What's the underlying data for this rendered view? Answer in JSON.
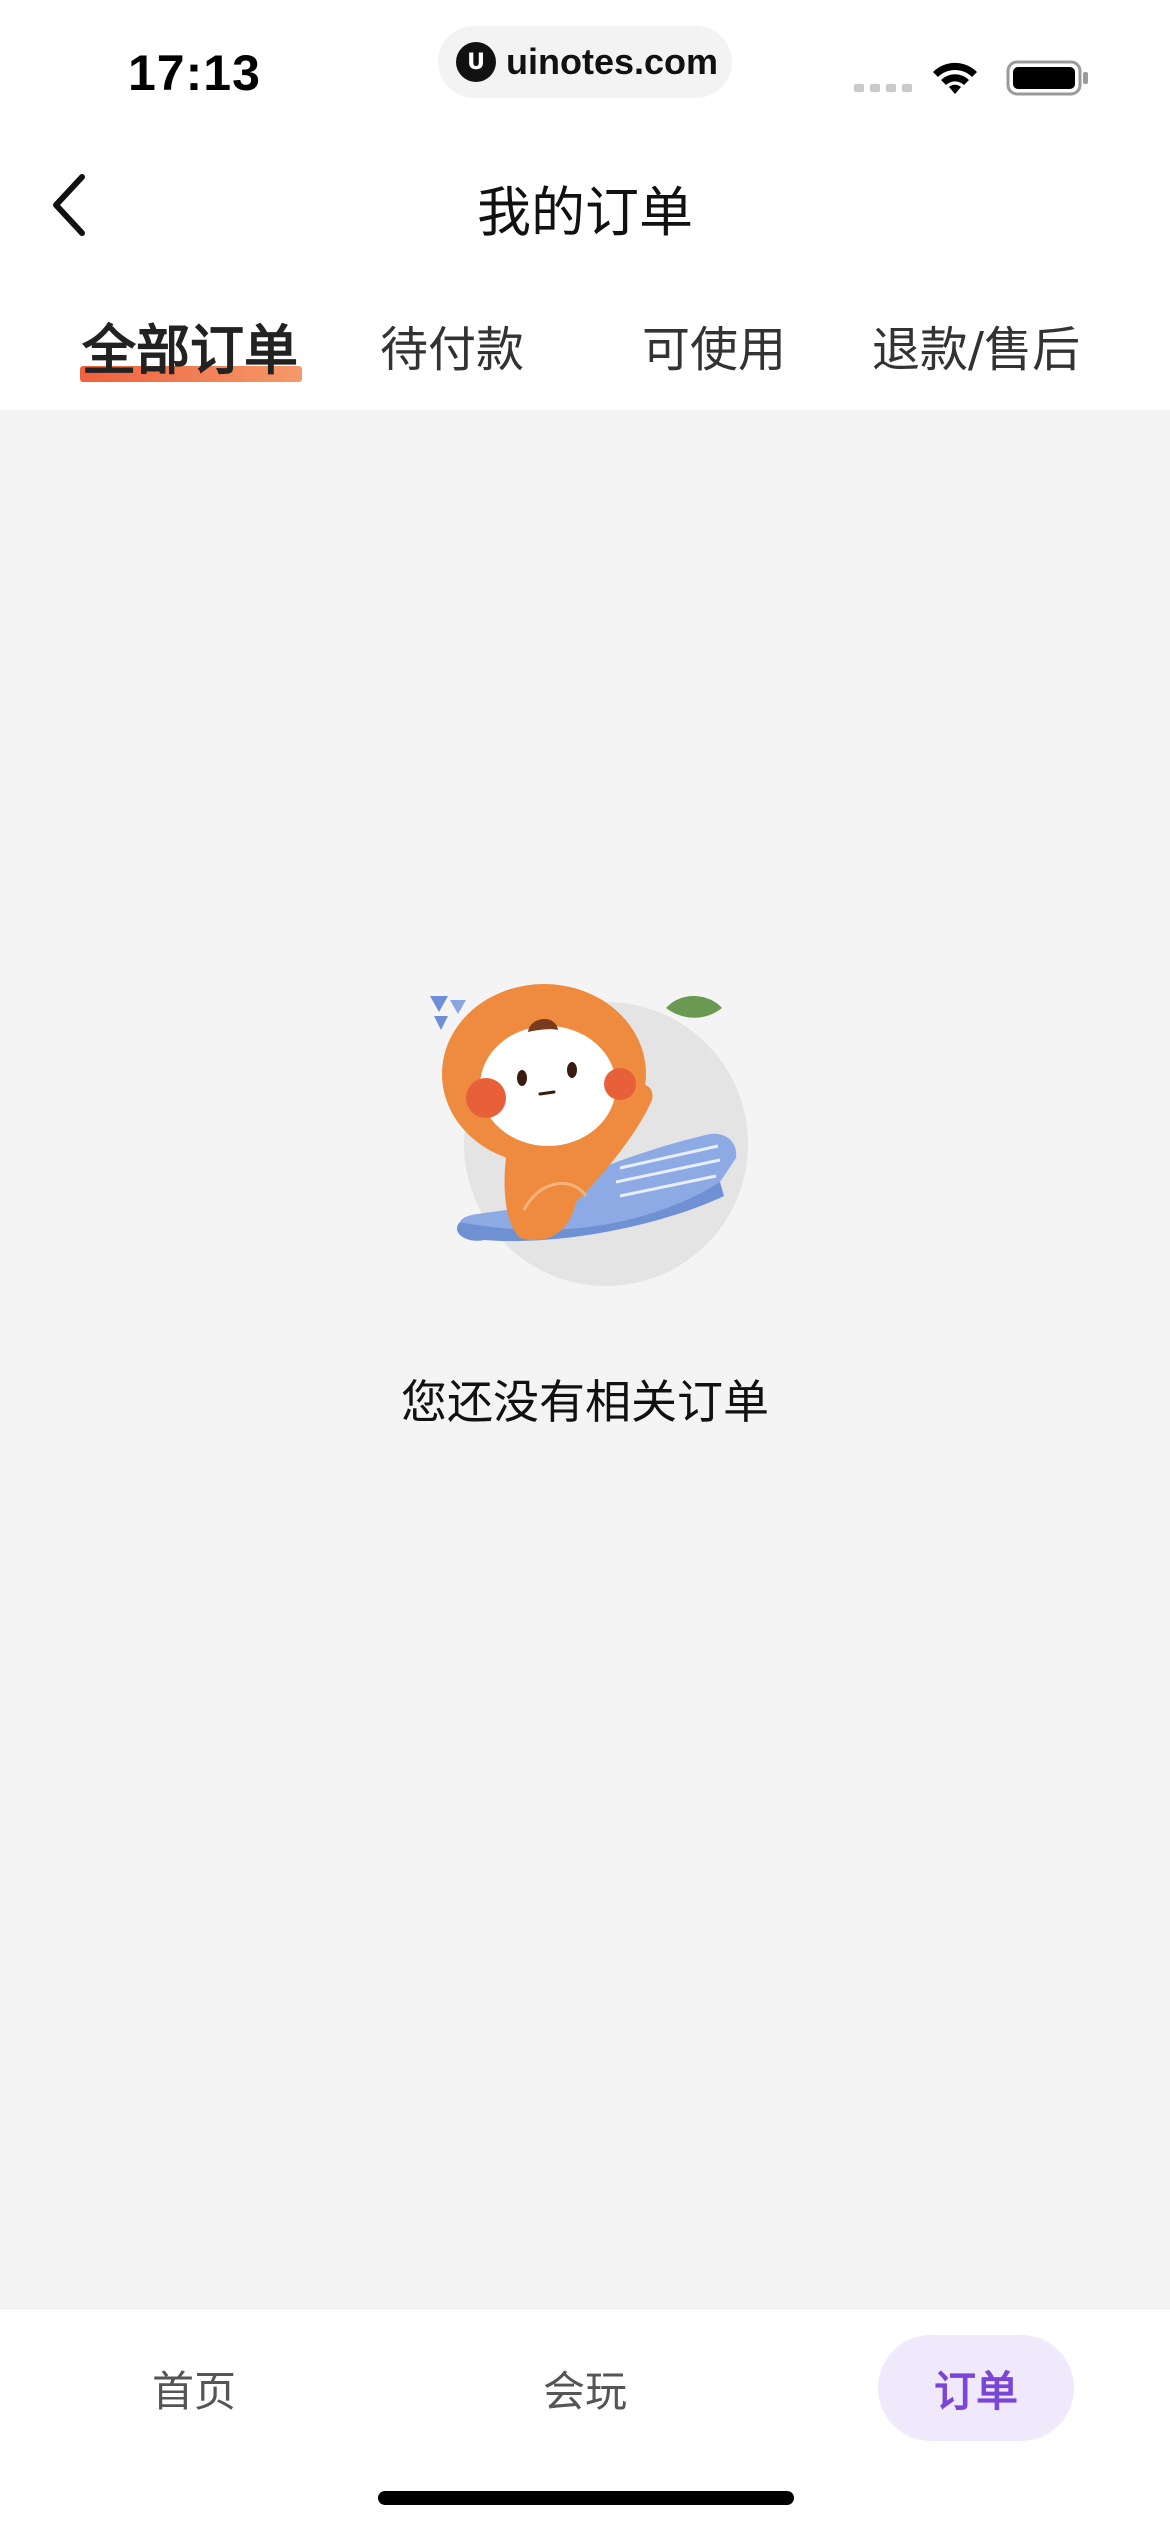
{
  "status_bar": {
    "time": "17:13",
    "url": "uinotes.com",
    "url_logo_glyph": "U",
    "icons": [
      "signal-icon",
      "wifi-icon",
      "battery-icon"
    ]
  },
  "header": {
    "title": "我的订单",
    "back_icon": "chevron-left-icon"
  },
  "tabs": [
    {
      "label": "全部订单",
      "active": true
    },
    {
      "label": "待付款",
      "active": false
    },
    {
      "label": "可使用",
      "active": false
    },
    {
      "label": "退款/售后",
      "active": false
    }
  ],
  "empty_state": {
    "message": "您还没有相关订单",
    "illustration": "orange-mascot-illustration"
  },
  "bottom_nav": {
    "items": [
      {
        "label": "首页",
        "active": false
      },
      {
        "label": "会玩",
        "active": false
      },
      {
        "label": "订单",
        "active": true
      }
    ]
  },
  "colors": {
    "tab_underline_start": "#f0603c",
    "tab_underline_end": "#f49a6a",
    "nav_active_text": "#7a46d8",
    "nav_active_bg": "#efe9fb",
    "page_background": "#f4f4f4"
  }
}
